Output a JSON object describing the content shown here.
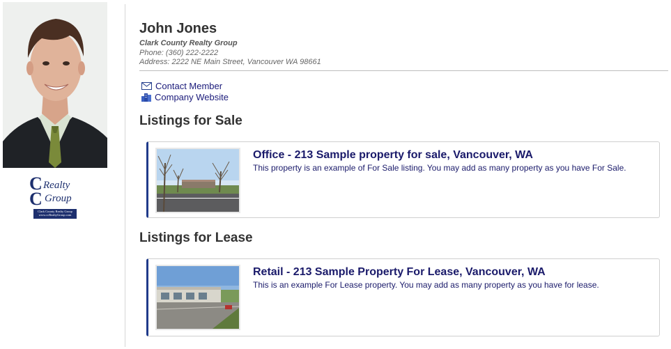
{
  "agent": {
    "name": "John Jones",
    "company": "Clark County Realty Group",
    "phone": "Phone: (360) 222-2222",
    "address": "Address: 2222 NE Main Street, Vancouver WA 98661"
  },
  "logo": {
    "word1": "Realty",
    "word2": "Group",
    "tag_line1": "Clark County Realty Group",
    "tag_line2": "www.ccRealtyGroup.com"
  },
  "links": {
    "contact": "Contact Member",
    "website": "Company Website"
  },
  "icons": {
    "contact": "envelope-icon",
    "website": "building-icon"
  },
  "sections": {
    "sale_title": "Listings for Sale",
    "lease_title": "Listings for Lease"
  },
  "listings_sale": [
    {
      "title": "Office - 213 Sample property for sale, Vancouver, WA",
      "description": "This property is an example of For Sale listing. You may add as many property as you have For Sale."
    }
  ],
  "listings_lease": [
    {
      "title": "Retail - 213 Sample Property For Lease, Vancouver, WA",
      "description": "This is an example For Lease property. You may add as many property as you have for lease."
    }
  ],
  "colors": {
    "accent": "#1f3a8a",
    "link": "#1a1a7a",
    "heading": "#333333"
  }
}
